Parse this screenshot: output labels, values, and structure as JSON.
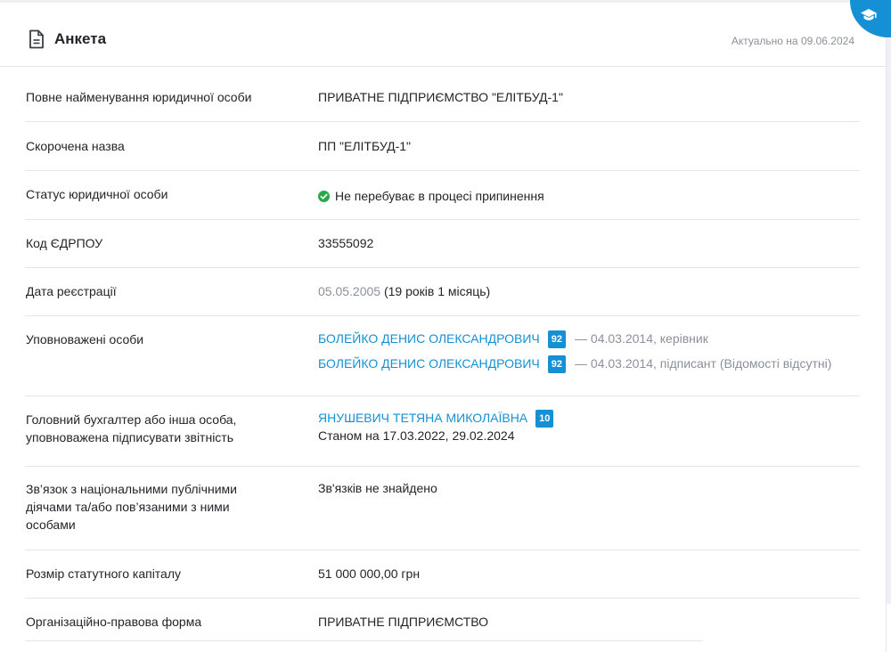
{
  "header": {
    "title": "Анкета",
    "date_text": "Актуально на 09.06.2024",
    "icon": "document-icon",
    "corner_icon": "graduation-cap-icon"
  },
  "colors": {
    "accent": "#1590d5",
    "success": "#2aa84a",
    "muted": "#8a9199"
  },
  "rows": {
    "full_name": {
      "label": "Повне найменування юридичної особи",
      "value": "ПРИВАТНЕ ПІДПРИЄМСТВО \"ЕЛІТБУД-1\""
    },
    "short_name": {
      "label": "Скорочена назва",
      "value": "ПП \"ЕЛІТБУД-1\""
    },
    "status": {
      "label": "Статус юридичної особи",
      "value": "Не перебуває в процесі припинення",
      "icon": "check-circle-icon"
    },
    "edrpou": {
      "label": "Код ЄДРПОУ",
      "value": "33555092"
    },
    "reg_date": {
      "label": "Дата реєстрації",
      "date": "05.05.2005",
      "age": "(19 років 1 місяць)"
    },
    "authorized": {
      "label": "Уповноважені особи",
      "persons": [
        {
          "name": "БОЛЕЙКО ДЕНИС ОЛЕКСАНДРОВИЧ",
          "badge": "92",
          "details": "— 04.03.2014, керівник"
        },
        {
          "name": "БОЛЕЙКО ДЕНИС ОЛЕКСАНДРОВИЧ",
          "badge": "92",
          "details": "— 04.03.2014, підписант (Відомості відсутні)"
        }
      ]
    },
    "accountant": {
      "label_line1": "Головний бухгалтер або інша особа,",
      "label_line2": "уповноважена підписувати звітність",
      "name": "ЯНУШЕВИЧ ТЕТЯНА МИКОЛАЇВНА",
      "badge": "10",
      "as_of": "Станом на 17.03.2022, 29.02.2024"
    },
    "pep": {
      "label_line1": "Зв’язок з національними публічними",
      "label_line2": "діячами та/або пов’язаними з ними",
      "label_line3": "особами",
      "value": "Зв'язків не знайдено"
    },
    "capital": {
      "label": "Розмір статутного капіталу",
      "value": "51 000 000,00 грн"
    },
    "legal_form": {
      "label": "Організаційно-правова форма",
      "value": "ПРИВАТНЕ ПІДПРИЄМСТВО"
    }
  }
}
